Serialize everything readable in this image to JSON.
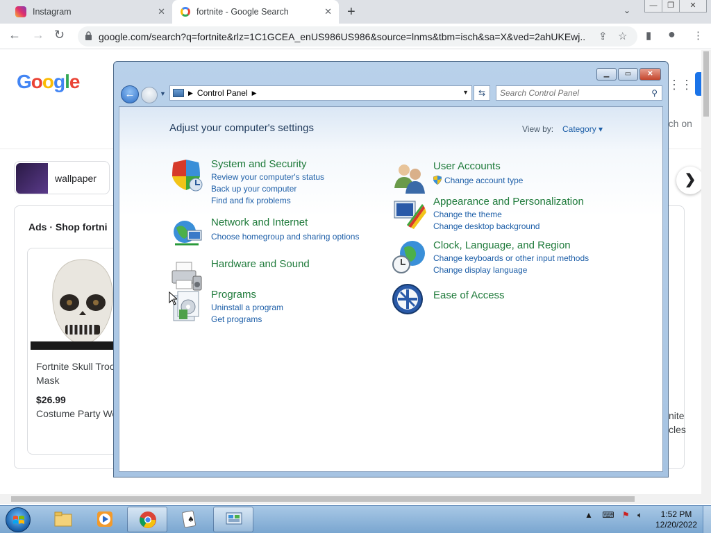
{
  "browser": {
    "tabs": [
      {
        "title": "Instagram",
        "close": "✕"
      },
      {
        "title": "fortnite - Google Search",
        "close": "✕"
      }
    ],
    "new_tab": "+",
    "tab_search": "⌄",
    "url": "google.com/search?q=fortnite&rlz=1C1GCEA_enUS986US986&source=lnms&tbm=isch&sa=X&ved=2ahUKEwj...",
    "back": "←",
    "forward": "→",
    "reload": "↻",
    "share": "⇪",
    "star": "☆",
    "sidepanel": "▮",
    "profile": "●",
    "menu": "⋮",
    "window_controls": {
      "minimize": "—",
      "restore": "❐",
      "close": "✕"
    }
  },
  "google_page": {
    "logo": "Google",
    "search_on": "rch on",
    "chip_label": "wallpaper",
    "ads_label": "Ads · Shop fortni",
    "product": {
      "name": "Fortnite Skull Trooper Mask",
      "price": "$26.99",
      "store": "Costume Party Wo"
    },
    "next": "❯",
    "apps": "⋮⋮⋮",
    "cut_text_right_1": "nite",
    "cut_text_right_2": "cles"
  },
  "control_panel": {
    "breadcrumb": "Control Panel",
    "search_placeholder": "Search Control Panel",
    "heading": "Adjust your computer's settings",
    "view_by_label": "View by:",
    "view_by_value": "Category",
    "left_categories": [
      {
        "title": "System and Security",
        "links": [
          "Review your computer's status",
          "Back up your computer",
          "Find and fix problems"
        ]
      },
      {
        "title": "Network and Internet",
        "links": [
          "Choose homegroup and sharing options"
        ]
      },
      {
        "title": "Hardware and Sound",
        "links": []
      },
      {
        "title": "Programs",
        "links": [
          "Uninstall a program",
          "Get programs"
        ]
      }
    ],
    "right_categories": [
      {
        "title": "User Accounts",
        "links": [
          "Change account type"
        ]
      },
      {
        "title": "Appearance and Personalization",
        "links": [
          "Change the theme",
          "Change desktop background"
        ]
      },
      {
        "title": "Clock, Language, and Region",
        "links": [
          "Change keyboards or other input methods",
          "Change display language"
        ]
      },
      {
        "title": "Ease of Access",
        "links": []
      }
    ]
  },
  "taskbar": {
    "time": "1:52 PM",
    "date": "12/20/2022"
  }
}
